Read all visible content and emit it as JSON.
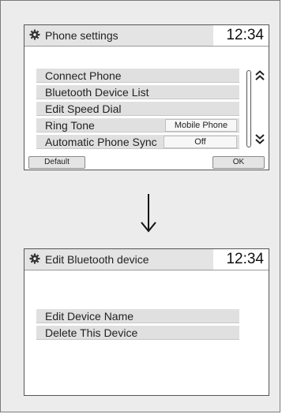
{
  "screen1": {
    "title": "Phone settings",
    "clock": "12:34",
    "menu": [
      {
        "label": "Connect Phone"
      },
      {
        "label": "Bluetooth Device List"
      },
      {
        "label": "Edit Speed Dial"
      },
      {
        "label": "Ring Tone",
        "value": "Mobile Phone"
      },
      {
        "label": "Automatic Phone Sync",
        "value": "Off"
      }
    ],
    "default_label": "Default",
    "ok_label": "OK",
    "icons": {
      "header": "gear-icon",
      "scroll_up": "double-chevron-up-icon",
      "scroll_down": "double-chevron-down-icon"
    }
  },
  "flow_arrow": "down-arrow-icon",
  "screen2": {
    "title": "Edit Bluetooth device",
    "clock": "12:34",
    "menu": [
      {
        "label": "Edit Device Name"
      },
      {
        "label": "Delete This Device"
      }
    ],
    "icons": {
      "header": "gear-icon"
    }
  }
}
